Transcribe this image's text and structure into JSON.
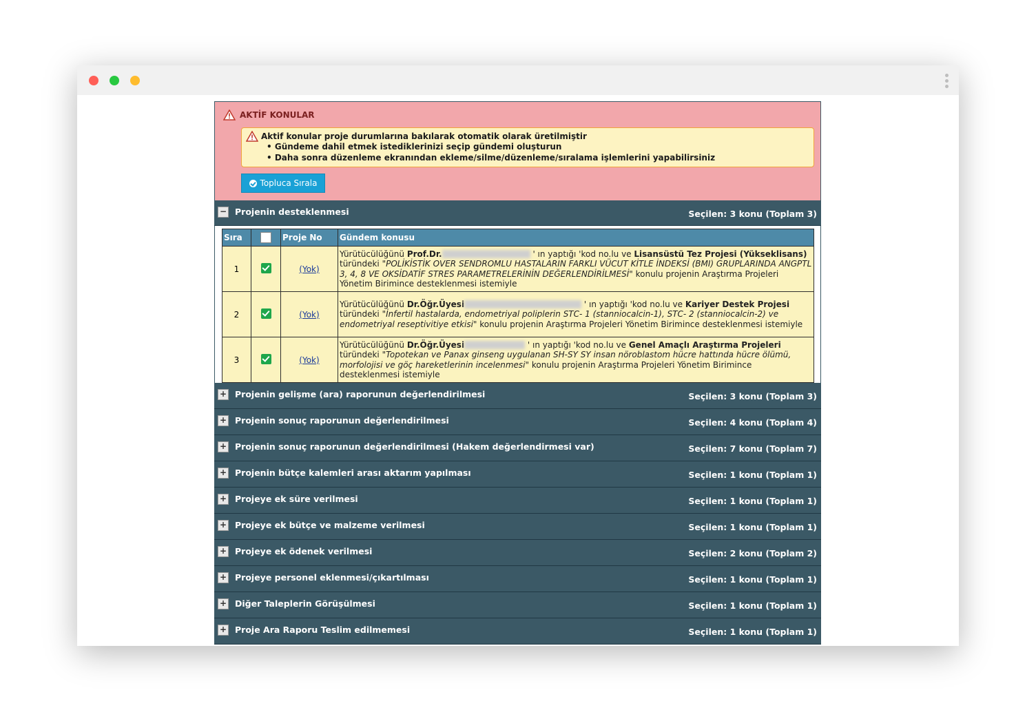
{
  "alert": {
    "title": "AKTİF KONULAR",
    "note_title": "Aktif konular proje durumlarına bakılarak otomatik olarak üretilmiştir",
    "bullets": [
      "• Gündeme dahil etmek istediklerinizi seçip gündemi oluşturun",
      "• Daha sonra düzenleme ekranından ekleme/silme/düzenleme/sıralama işlemlerini yapabilirsiniz"
    ],
    "sort_button": "Topluca Sırala"
  },
  "sections": [
    {
      "toggle": "−",
      "title": "Projenin desteklenmesi",
      "count": "Seçilen: 3 konu (Toplam 3)"
    },
    {
      "toggle": "+",
      "title": "Projenin gelişme (ara) raporunun değerlendirilmesi",
      "count": "Seçilen: 3 konu (Toplam 3)"
    },
    {
      "toggle": "+",
      "title": "Projenin sonuç raporunun değerlendirilmesi",
      "count": "Seçilen: 4 konu (Toplam 4)"
    },
    {
      "toggle": "+",
      "title": "Projenin sonuç raporunun değerlendirilmesi (Hakem değerlendirmesi var)",
      "count": "Seçilen: 7 konu (Toplam 7)"
    },
    {
      "toggle": "+",
      "title": "Projenin bütçe kalemleri arası aktarım yapılması",
      "count": "Seçilen: 1 konu (Toplam 1)"
    },
    {
      "toggle": "+",
      "title": "Projeye ek süre verilmesi",
      "count": "Seçilen: 1 konu (Toplam 1)"
    },
    {
      "toggle": "+",
      "title": "Projeye ek bütçe ve malzeme verilmesi",
      "count": "Seçilen: 1 konu (Toplam 1)"
    },
    {
      "toggle": "+",
      "title": "Projeye ek ödenek verilmesi",
      "count": "Seçilen: 2 konu (Toplam 2)"
    },
    {
      "toggle": "+",
      "title": "Projeye personel eklenmesi/çıkartılması",
      "count": "Seçilen: 1 konu (Toplam 1)"
    },
    {
      "toggle": "+",
      "title": "Diğer Taleplerin Görüşülmesi",
      "count": "Seçilen: 1 konu (Toplam 1)"
    },
    {
      "toggle": "+",
      "title": "Proje Ara Raporu Teslim edilmemesi",
      "count": "Seçilen: 1 konu (Toplam 1)"
    }
  ],
  "table": {
    "headers": {
      "sira": "Sıra",
      "proje_no": "Proje No",
      "gundem": "Gündem konusu"
    },
    "rows": [
      {
        "sira": "1",
        "proje_no": "(Yok)",
        "p1": "Yürütücülüğünü ",
        "title_person": "Prof.Dr.",
        "p2": " ' ın yaptığı 'kod no.lu ve ",
        "proj_type": "Lisansüstü Tez Projesi (Yükseklisans)",
        "p3": " türündeki ",
        "proj_name": "\"POLİKİSTİK OVER SENDROMLU HASTALARIN FARKLI VÜCUT KİTLE İNDEKSİ (BMI) GRUPLARINDA ANGPTL 3, 4, 8 VE OKSİDATİF STRES PARAMETRELERİNİN DEĞERLENDİRİLMESİ\"",
        "p4": " konulu projenin Araştırma Projeleri Yönetim Birimince desteklenmesi istemiyle"
      },
      {
        "sira": "2",
        "proje_no": "(Yok)",
        "p1": "Yürütücülüğünü ",
        "title_person": "Dr.Öğr.Üyesi",
        "p2": " ' ın yaptığı 'kod no.lu ve ",
        "proj_type": "Kariyer Destek Projesi",
        "p3": " türündeki ",
        "proj_name": "\"İnfertil hastalarda, endometriyal poliplerin STC- 1 (stanniocalcin-1), STC- 2 (stanniocalcin-2) ve endometriyal reseptivitiye etkisi\"",
        "p4": " konulu projenin Araştırma Projeleri Yönetim Birimince desteklenmesi istemiyle"
      },
      {
        "sira": "3",
        "proje_no": "(Yok)",
        "p1": "Yürütücülüğünü ",
        "title_person": "Dr.Öğr.Üyesi",
        "p2": " ' ın yaptığı 'kod no.lu ve ",
        "proj_type": "Genel Amaçlı Araştırma Projeleri",
        "p3": " türündeki ",
        "proj_name": "\"Topotekan ve Panax ginseng uygulanan SH-SY SY insan nöroblastom hücre hattında hücre ölümü, morfolojisi ve göç hareketlerinin incelenmesi\"",
        "p4": " konulu projenin Araştırma Projeleri Yönetim Birimince desteklenmesi istemiyle"
      }
    ]
  }
}
